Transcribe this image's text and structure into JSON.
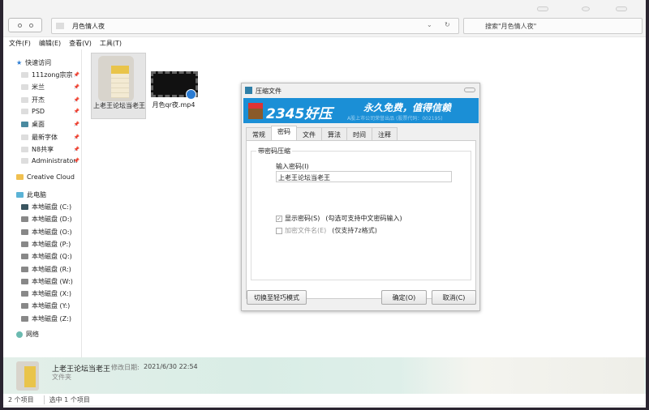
{
  "explorer": {
    "address": "月色情人夜",
    "search_placeholder": "搜索\"月色情人夜\"",
    "menu": [
      "文件(F)",
      "编辑(E)",
      "查看(V)",
      "工具(T)"
    ],
    "sidebar": {
      "quick_access": "快速访问",
      "quick_items": [
        "111zong宗宗",
        "米兰",
        "开杰",
        "PSD",
        "桌面",
        "最新字体",
        "N8共享",
        "Administrator."
      ],
      "creative_cloud": "Creative Cloud Fil",
      "this_pc": "此电脑",
      "drives": [
        "本地磁盘 (C:)",
        "本地磁盘 (D:)",
        "本地磁盘 (O:)",
        "本地磁盘 (P:)",
        "本地磁盘 (Q:)",
        "本地磁盘 (R:)",
        "本地磁盘 (W:)",
        "本地磁盘 (X:)",
        "本地磁盘 (Y:)",
        "本地磁盘 (Z:)"
      ],
      "network": "网络"
    },
    "files": [
      {
        "name": "上老王论坛当老王",
        "type": "folder"
      },
      {
        "name": "月色qr夜.mp4",
        "type": "video"
      }
    ],
    "details": {
      "name": "上老王论坛当老王",
      "modified_label": "修改日期:",
      "modified": "2021/6/30 22:54",
      "type": "文件夹"
    },
    "status": {
      "count": "2 个项目",
      "selected": "选中 1 个项目"
    }
  },
  "dialog": {
    "title": "压缩文件",
    "banner": {
      "logo": "2345好压",
      "slogan": "永久免费，值得信赖",
      "sub": "A股上市公司荣誉出品 (股票代码：002195)"
    },
    "tabs": [
      "常规",
      "密码",
      "文件",
      "算法",
      "时间",
      "注释"
    ],
    "active_tab": "密码",
    "group_title": "带密码压缩",
    "password_label": "输入密码(I)",
    "password_value": "上老王论坛当老王",
    "show_password": {
      "label": "显示密码(S)",
      "hint": "(勾选可支持中文密码输入)",
      "checked": true
    },
    "encrypt_names": {
      "label": "加密文件名(E)",
      "hint": "(仅支持7z格式)",
      "checked": false
    },
    "buttons": {
      "switch": "切换至轻巧模式",
      "ok": "确定(O)",
      "cancel": "取消(C)"
    }
  },
  "colors": {
    "banner": "#1b8fd6",
    "accent": "#2b7cd3"
  }
}
